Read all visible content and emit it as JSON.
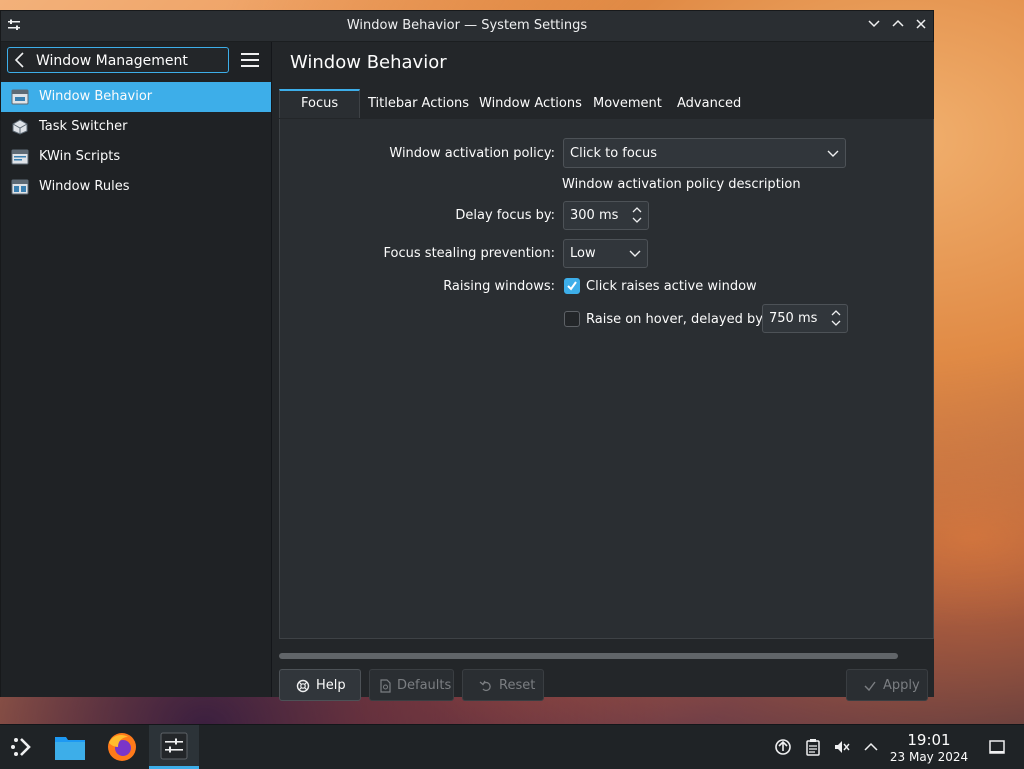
{
  "window": {
    "title": "Window Behavior — System Settings"
  },
  "sidebar": {
    "back_label": "Window Management",
    "items": [
      {
        "label": "Window Behavior",
        "icon": "window-behavior-icon",
        "active": true
      },
      {
        "label": "Task Switcher",
        "icon": "task-switcher-icon",
        "active": false
      },
      {
        "label": "KWin Scripts",
        "icon": "kwin-scripts-icon",
        "active": false
      },
      {
        "label": "Window Rules",
        "icon": "window-rules-icon",
        "active": false
      }
    ]
  },
  "page": {
    "title": "Window Behavior",
    "tabs": [
      "Focus",
      "Titlebar Actions",
      "Window Actions",
      "Movement",
      "Advanced"
    ],
    "active_tab": "Focus"
  },
  "form": {
    "activation_policy_label": "Window activation policy:",
    "activation_policy_value": "Click to focus",
    "activation_policy_desc": "Window activation policy description",
    "delay_label": "Delay focus by:",
    "delay_value": "300 ms",
    "stealing_label": "Focus stealing prevention:",
    "stealing_value": "Low",
    "raising_label": "Raising windows:",
    "click_raises_label": "Click raises active window",
    "click_raises_checked": true,
    "raise_hover_label": "Raise on hover, delayed by:",
    "raise_hover_checked": false,
    "raise_hover_delay": "750 ms"
  },
  "buttons": {
    "help": "Help",
    "defaults": "Defaults",
    "reset": "Reset",
    "apply": "Apply"
  },
  "taskbar": {
    "time": "19:01",
    "date": "23 May 2024"
  },
  "colors": {
    "accent": "#3daee9",
    "window_bg": "#232629"
  }
}
